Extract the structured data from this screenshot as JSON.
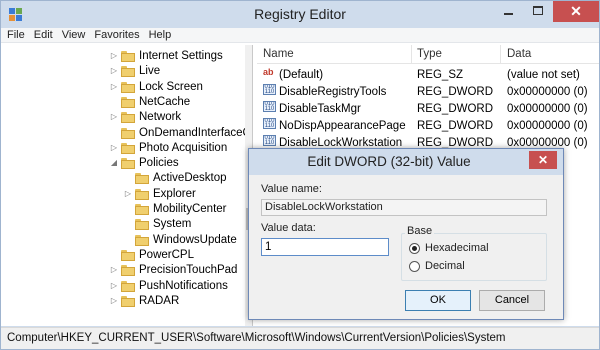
{
  "window": {
    "title": "Registry Editor",
    "close_glyph": "✕"
  },
  "menubar": {
    "items": [
      "File",
      "Edit",
      "View",
      "Favorites",
      "Help"
    ]
  },
  "tree": {
    "items": [
      {
        "label": "Internet Settings",
        "expander": "▷"
      },
      {
        "label": "Live",
        "expander": "▷"
      },
      {
        "label": "Lock Screen",
        "expander": "▷"
      },
      {
        "label": "NetCache",
        "expander": ""
      },
      {
        "label": "Network",
        "expander": "▷"
      },
      {
        "label": "OnDemandInterfaceCa",
        "expander": ""
      },
      {
        "label": "Photo Acquisition",
        "expander": "▷"
      },
      {
        "label": "Policies",
        "expander": "◢"
      },
      {
        "label": "ActiveDesktop",
        "expander": ""
      },
      {
        "label": "Explorer",
        "expander": "▷"
      },
      {
        "label": "MobilityCenter",
        "expander": ""
      },
      {
        "label": "System",
        "expander": ""
      },
      {
        "label": "WindowsUpdate",
        "expander": ""
      },
      {
        "label": "PowerCPL",
        "expander": ""
      },
      {
        "label": "PrecisionTouchPad",
        "expander": "▷"
      },
      {
        "label": "PushNotifications",
        "expander": "▷"
      },
      {
        "label": "RADAR",
        "expander": "▷"
      }
    ]
  },
  "list": {
    "columns": {
      "name": "Name",
      "type": "Type",
      "data": "Data"
    },
    "rows": [
      {
        "name": "(Default)",
        "type": "REG_SZ",
        "data": "(value not set)",
        "icon": "ab"
      },
      {
        "name": "DisableRegistryTools",
        "type": "REG_DWORD",
        "data": "0x00000000 (0)",
        "icon": "dword"
      },
      {
        "name": "DisableTaskMgr",
        "type": "REG_DWORD",
        "data": "0x00000000 (0)",
        "icon": "dword"
      },
      {
        "name": "NoDispAppearancePage",
        "type": "REG_DWORD",
        "data": "0x00000000 (0)",
        "icon": "dword"
      },
      {
        "name": "DisableLockWorkstation",
        "type": "REG_DWORD",
        "data": "0x00000000 (0)",
        "icon": "dword"
      }
    ]
  },
  "dialog": {
    "title": "Edit DWORD (32-bit) Value",
    "close_glyph": "✕",
    "value_name_label": "Value name:",
    "value_name": "DisableLockWorkstation",
    "value_data_label": "Value data:",
    "value_data": "1",
    "base_label": "Base",
    "hex_label": "Hexadecimal",
    "dec_label": "Decimal",
    "selected_base": "Hexadecimal",
    "ok_label": "OK",
    "cancel_label": "Cancel"
  },
  "statusbar": {
    "path": "Computer\\HKEY_CURRENT_USER\\Software\\Microsoft\\Windows\\CurrentVersion\\Policies\\System"
  },
  "colors": {
    "titlebar": "#cfdcec",
    "close_button": "#c75050",
    "folder": "#f0cf6e"
  }
}
